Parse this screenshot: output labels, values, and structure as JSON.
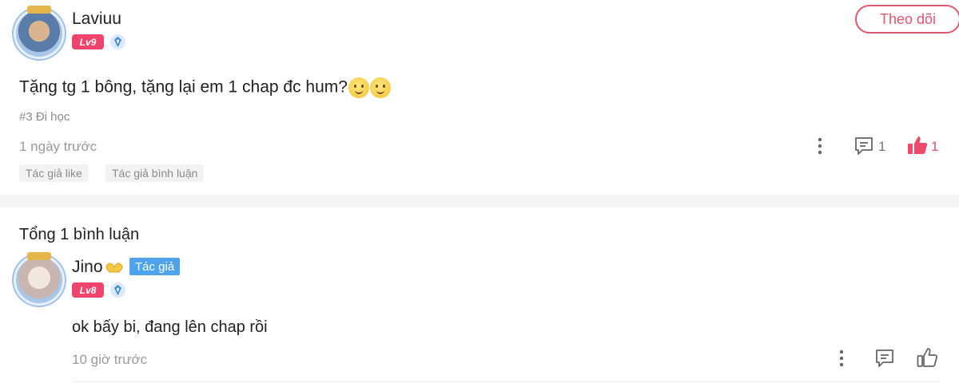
{
  "post": {
    "username": "Laviuu",
    "level": "Lv9",
    "follow_label": "Theo dõi",
    "content": "Tặng tg 1 bông, tặng lại em 1 chap đc hum?",
    "chapter": "#3 Đi học",
    "time": "1 ngày trước",
    "comment_count": "1",
    "like_count": "1",
    "tags": [
      "Tác giả like",
      "Tác giả bình luận"
    ],
    "accent_color": "#e0566f"
  },
  "comments_section": {
    "title": "Tổng 1 bình luận"
  },
  "reply": {
    "username": "Jino",
    "author_badge": "Tác giả",
    "level": "Lv8",
    "content": "ok bấy bi, đang lên chap rồi",
    "time": "10 giờ trước",
    "badge_color": "#4da3ee"
  }
}
